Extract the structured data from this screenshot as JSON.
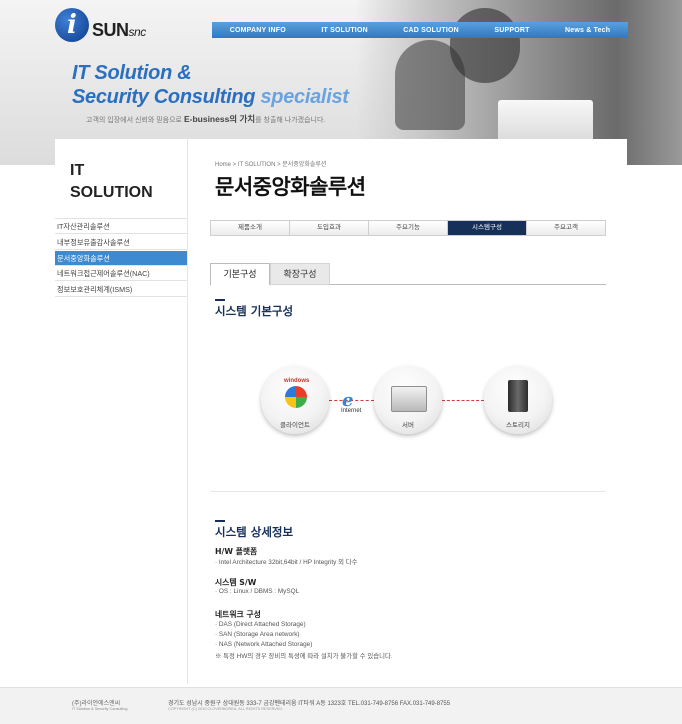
{
  "header": {
    "logo": {
      "mark": "i",
      "name": "SUN",
      "suffix": "snc"
    },
    "nav": [
      "COMPANY INFO",
      "IT SOLUTION",
      "CAD SOLUTION",
      "SUPPORT",
      "News & Tech"
    ],
    "slogan_line1": "IT Solution &",
    "slogan_line2_a": "Security Consulting ",
    "slogan_line2_b": "specialist",
    "subcopy_a": "고객의 입장에서 신뢰와 믿음으로 ",
    "subcopy_b": "E-business의 가치",
    "subcopy_c": "를 창출해 나가겠습니다."
  },
  "sidebar": {
    "title_line1": "IT",
    "title_line2": "SOLUTION",
    "items": [
      {
        "label": "IT자산관리솔루션"
      },
      {
        "label": "내부정보유출감사솔루션"
      },
      {
        "label": "문서중앙화솔루션"
      },
      {
        "label": "네트워크접근제어솔루션(NAC)"
      },
      {
        "label": "정보보호관리체계(ISMS)"
      }
    ]
  },
  "breadcrumb": "Home > IT SOLUTION > 문서중앙화솔루션",
  "page_title": "문서중앙화솔루션",
  "tabs": [
    "제품소개",
    "도입효과",
    "주요기능",
    "시스템구성",
    "주요고객"
  ],
  "subtabs": [
    "기본구성",
    "확장구성"
  ],
  "section1": {
    "title": "시스템 기본구성"
  },
  "diagram": {
    "client_label": "클라이언트",
    "windows_label": "windows",
    "internet_label": "Internet",
    "server_label": "서버",
    "storage_label": "스토리지"
  },
  "section2": {
    "title": "시스템 상세정보",
    "hw_head": "H/W 플랫폼",
    "hw_line": "· Intel Architecture 32bit,64bit / HP Integrity 외 다수",
    "sw_head": "시스템 S/W",
    "sw_line": "· OS : Linux / DBMS : MySQL",
    "net_head": "네트워크 구성",
    "net_lines": [
      "· DAS (Direct Attached Storage)",
      "· SAN (Storage Area network)",
      "· NAS (Network Attached Storage)",
      "※ 특정 HW의 경우 장비의 특성에 따라 설치가 불가할 수 있습니다."
    ]
  },
  "footer": {
    "company": "(주)라이언에스엔씨",
    "company_sub": "IT Solution & Security Consulting",
    "address": "경기도 성남시 중원구 상대원동 333-7 금강펜테리움 IT타워 A동 1323호   TEL.031-749-8756   FAX.031-749-8755",
    "copyright": "COPYRIGHT (C) 2010 CLOVERBOREA. ALL RIGHTS RESERVED."
  }
}
